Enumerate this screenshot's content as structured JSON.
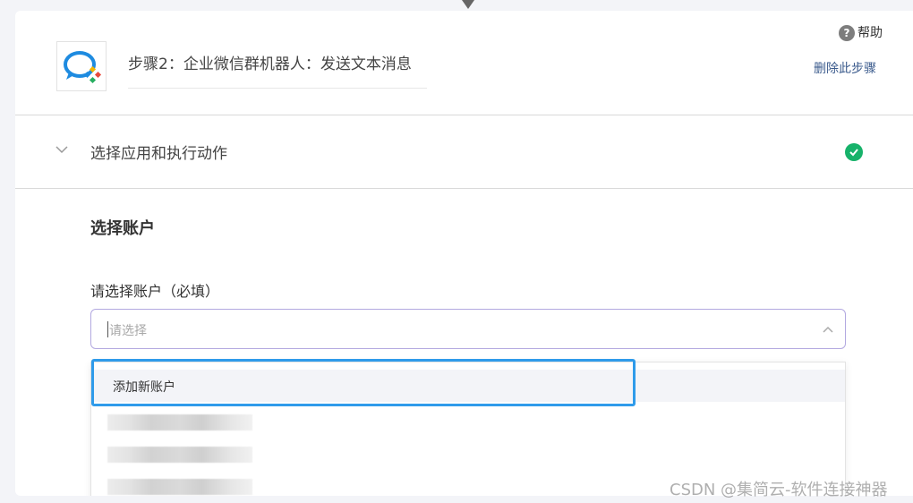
{
  "step": {
    "title": "步骤2：企业微信群机器人：发送文本消息",
    "app_icon": "wecom-logo-icon",
    "help_label": "帮助",
    "delete_label": "删除此步骤"
  },
  "section": {
    "label": "选择应用和执行动作",
    "status_icon": "check-circle-icon",
    "status_color": "#17b26a"
  },
  "account": {
    "heading": "选择账户",
    "field_label": "请选择账户（必填）",
    "placeholder": "请选择",
    "dropdown": {
      "add_option_label": "添加新账户",
      "accent_color": "#2f9bea"
    }
  },
  "watermark": "CSDN @集简云-软件连接神器"
}
